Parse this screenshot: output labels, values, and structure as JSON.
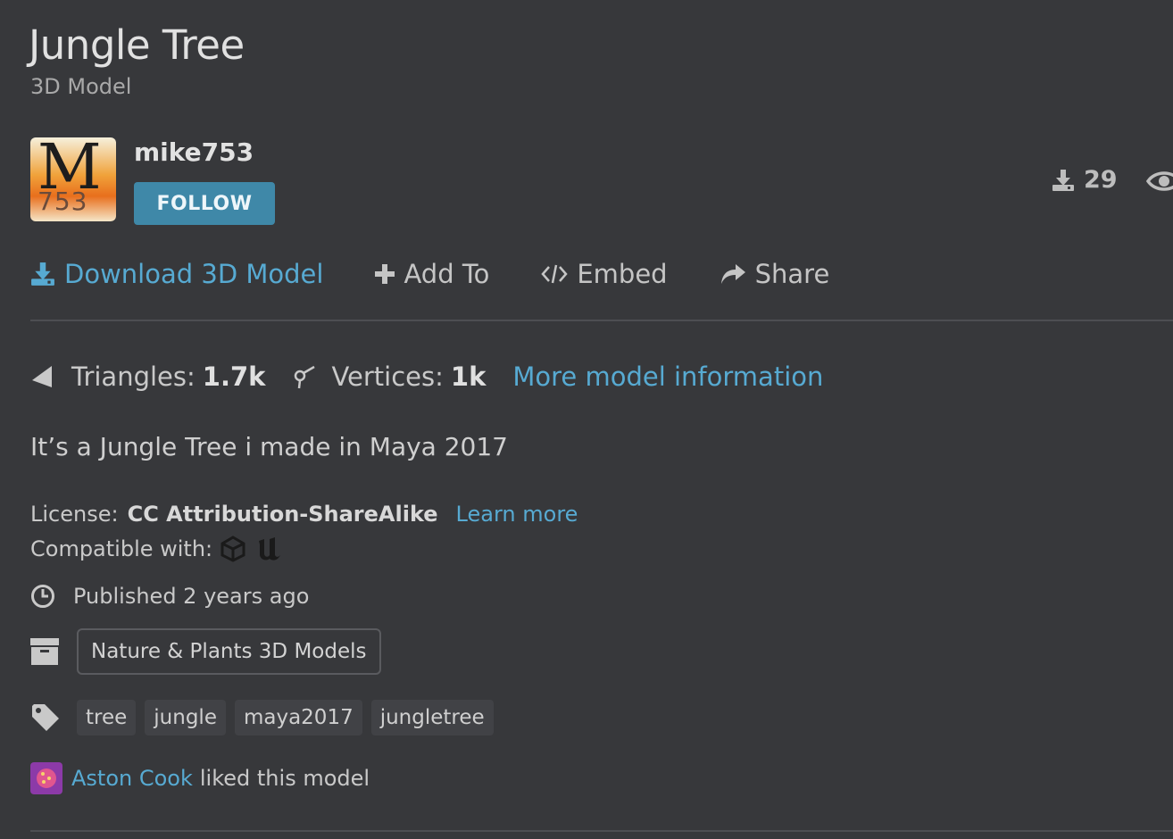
{
  "header": {
    "title": "Jungle Tree",
    "subtitle": "3D Model"
  },
  "author": {
    "avatar_text_main": "M",
    "avatar_text_sub": "753",
    "username": "mike753",
    "follow_label": "FOLLOW"
  },
  "counters": {
    "downloads": "29",
    "download_icon": "download-icon",
    "views_icon": "eye-icon"
  },
  "actions": [
    {
      "label": "Download 3D Model",
      "icon": "download-icon"
    },
    {
      "label": "Add To",
      "icon": "plus-icon"
    },
    {
      "label": "Embed",
      "icon": "code-icon"
    },
    {
      "label": "Share",
      "icon": "share-icon"
    }
  ],
  "stats": {
    "triangles_label": "Triangles:",
    "triangles_value": "1.7k",
    "vertices_label": "Vertices:",
    "vertices_value": "1k",
    "more_info": "More model information"
  },
  "description": "It’s a Jungle Tree i made in Maya 2017",
  "license": {
    "label": "License:",
    "name": "CC Attribution-ShareAlike",
    "learn_more": "Learn more"
  },
  "compatibility": {
    "label": "Compatible with:",
    "engines": [
      "unity-icon",
      "unreal-icon"
    ]
  },
  "published": {
    "text": "Published 2 years ago"
  },
  "category": {
    "label": "Nature & Plants 3D Models"
  },
  "tags": [
    "tree",
    "jungle",
    "maya2017",
    "jungletree"
  ],
  "liked": {
    "user": "Aston Cook",
    "text": "liked this model"
  },
  "colors": {
    "background": "#37383b",
    "accent": "#57aad2",
    "follow_button": "#3f88a8"
  }
}
